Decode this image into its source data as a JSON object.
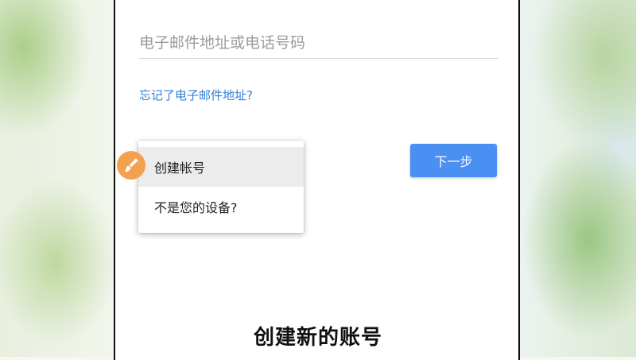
{
  "email_field": {
    "placeholder": "电子邮件地址或电话号码",
    "value": ""
  },
  "forgot_link": "忘记了电子邮件地址?",
  "next_button": "下一步",
  "popup_menu": {
    "items": [
      {
        "label": "创建帐号",
        "highlighted": true
      },
      {
        "label": "不是您的设备?",
        "highlighted": false
      }
    ]
  },
  "brush_badge": {
    "icon": "brush-icon",
    "color": "#f4a14f"
  },
  "caption": "创建新的账号",
  "colors": {
    "link": "#2f7fd6",
    "primary_button": "#4a8ff2",
    "menu_highlight": "#ececec"
  }
}
